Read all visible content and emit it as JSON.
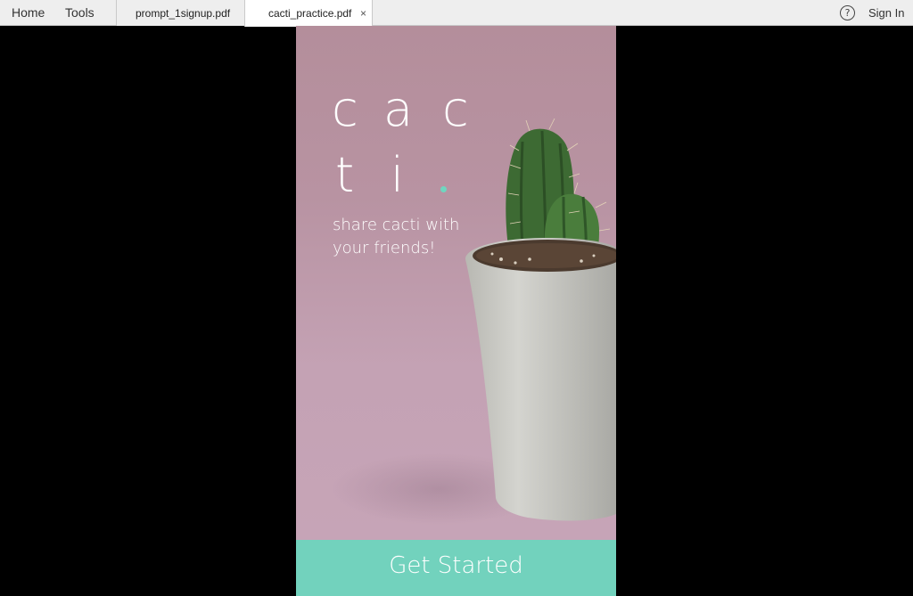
{
  "toolbar": {
    "home_label": "Home",
    "tools_label": "Tools",
    "tabs": [
      {
        "label": "prompt_1signup.pdf",
        "active": false
      },
      {
        "label": "cacti_practice.pdf",
        "active": true,
        "close": "×"
      }
    ],
    "help_glyph": "?",
    "sign_in_label": "Sign In"
  },
  "document": {
    "logo_line1": [
      "c",
      "a",
      "c"
    ],
    "logo_line2": [
      "t",
      "i"
    ],
    "tagline": "share cacti with your friends!",
    "cta_label": "Get Started",
    "colors": {
      "background": "#b893a2",
      "accent": "#72d2bd",
      "dot": "#6fd6c0",
      "text": "#ffffff"
    }
  }
}
